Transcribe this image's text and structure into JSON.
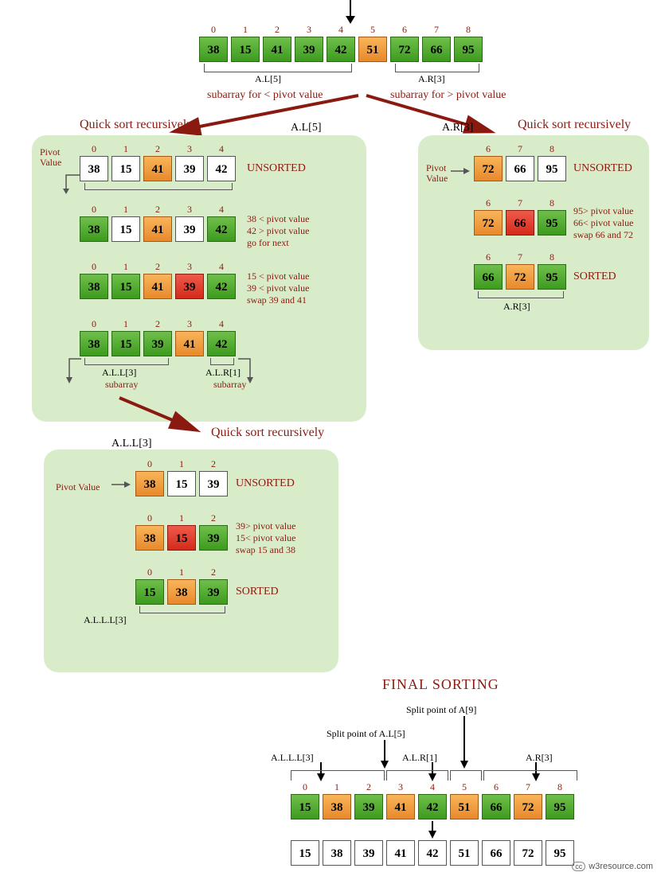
{
  "chart_data": {
    "type": "diagram",
    "algorithm": "Quick sort",
    "original_array": [
      38,
      15,
      41,
      39,
      42,
      51,
      72,
      66,
      95
    ],
    "final_sorted": [
      15,
      38,
      39,
      41,
      42,
      51,
      66,
      72,
      95
    ]
  },
  "top": {
    "idx": [
      "0",
      "1",
      "2",
      "3",
      "4",
      "5",
      "6",
      "7",
      "8"
    ],
    "vals": [
      "38",
      "15",
      "41",
      "39",
      "42",
      "51",
      "72",
      "66",
      "95"
    ],
    "al_label": "A.L[5]",
    "ar_label": "A.R[3]",
    "sub_left": "subarray for < pivot value",
    "sub_right": "subarray for > pivot value"
  },
  "titles": {
    "qsr_left": "Quick sort recursively",
    "qsr_right": "Quick sort recursively",
    "qsr_bottom": "Quick sort recursively",
    "final": "FINAL SORTING"
  },
  "left_panel": {
    "header": "A.L[5]",
    "pivot_label": "Pivot\nValue",
    "r1": {
      "idx": [
        "0",
        "1",
        "2",
        "3",
        "4"
      ],
      "vals": [
        "38",
        "15",
        "41",
        "39",
        "42"
      ],
      "note": "UNSORTED"
    },
    "r2": {
      "idx": [
        "0",
        "1",
        "2",
        "3",
        "4"
      ],
      "vals": [
        "38",
        "15",
        "41",
        "39",
        "42"
      ],
      "note": "38 < pivot value\n42 > pivot value\ngo for next"
    },
    "r3": {
      "idx": [
        "0",
        "1",
        "2",
        "3",
        "4"
      ],
      "vals": [
        "38",
        "15",
        "41",
        "39",
        "42"
      ],
      "note": "15 < pivot value\n39 < pivot value\nswap 39 and 41"
    },
    "r4": {
      "idx": [
        "0",
        "1",
        "2",
        "3",
        "4"
      ],
      "vals": [
        "38",
        "15",
        "39",
        "41",
        "42"
      ]
    },
    "all_label": "A.L.L[3]",
    "alr_label": "A.L.R[1]",
    "sub": "subarray"
  },
  "right_panel": {
    "header": "A.R[3]",
    "pivot_label": "Pivot\nValue",
    "r1": {
      "idx": [
        "6",
        "7",
        "8"
      ],
      "vals": [
        "72",
        "66",
        "95"
      ],
      "note": "UNSORTED"
    },
    "r2": {
      "idx": [
        "6",
        "7",
        "8"
      ],
      "vals": [
        "72",
        "66",
        "95"
      ],
      "note": "95> pivot value\n66< pivot value\nswap 66 and 72"
    },
    "r3": {
      "idx": [
        "6",
        "7",
        "8"
      ],
      "vals": [
        "66",
        "72",
        "95"
      ],
      "note": "SORTED"
    },
    "footer_label": "A.R[3]"
  },
  "bottom_panel": {
    "header": "A.L.L[3]",
    "pivot_label": "Pivot Value",
    "r1": {
      "idx": [
        "0",
        "1",
        "2"
      ],
      "vals": [
        "38",
        "15",
        "39"
      ],
      "note": "UNSORTED"
    },
    "r2": {
      "idx": [
        "0",
        "1",
        "2"
      ],
      "vals": [
        "38",
        "15",
        "39"
      ],
      "note": "39> pivot value\n15< pivot value\nswap 15 and 38"
    },
    "r3": {
      "idx": [
        "0",
        "1",
        "2"
      ],
      "vals": [
        "15",
        "38",
        "39"
      ],
      "note": "SORTED"
    },
    "footer_label": "A.L.L.L[3]"
  },
  "final": {
    "split_a9": "Split point of A[9]",
    "split_al5": "Split point of A.L[5]",
    "alll": "A.L.L.L[3]",
    "alr": "A.L.R[1]",
    "ar": "A.R[3]",
    "idx": [
      "0",
      "1",
      "2",
      "3",
      "4",
      "5",
      "6",
      "7",
      "8"
    ],
    "vals": [
      "15",
      "38",
      "39",
      "41",
      "42",
      "51",
      "66",
      "72",
      "95"
    ],
    "sorted": [
      "15",
      "38",
      "39",
      "41",
      "42",
      "51",
      "66",
      "72",
      "95"
    ]
  },
  "footer": "w3resource.com"
}
